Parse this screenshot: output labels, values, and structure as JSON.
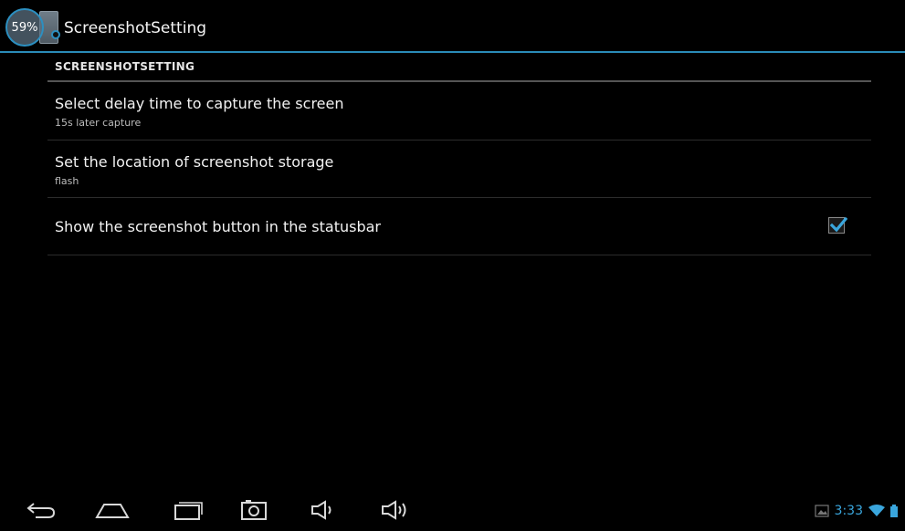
{
  "action_bar": {
    "battery_percent": "59%",
    "title": "ScreenshotSetting"
  },
  "section": {
    "header": "SCREENSHOTSETTING"
  },
  "preferences": [
    {
      "title": "Select delay time to capture the screen",
      "summary": "15s later capture"
    },
    {
      "title": "Set the location of screenshot storage",
      "summary": "flash"
    },
    {
      "title": "Show the screenshot button in the statusbar",
      "checked": true
    }
  ],
  "nav_bar": {
    "buttons": [
      "back-icon",
      "home-icon",
      "recent-apps-icon",
      "screenshot-icon",
      "volume-down-icon",
      "volume-up-icon"
    ]
  },
  "status_bar": {
    "time": "3:33",
    "icons": [
      "gallery-notification-icon",
      "wifi-icon",
      "battery-icon"
    ]
  },
  "colors": {
    "accent": "#2a8bb8",
    "time": "#3aa6dd",
    "background": "#000000"
  }
}
